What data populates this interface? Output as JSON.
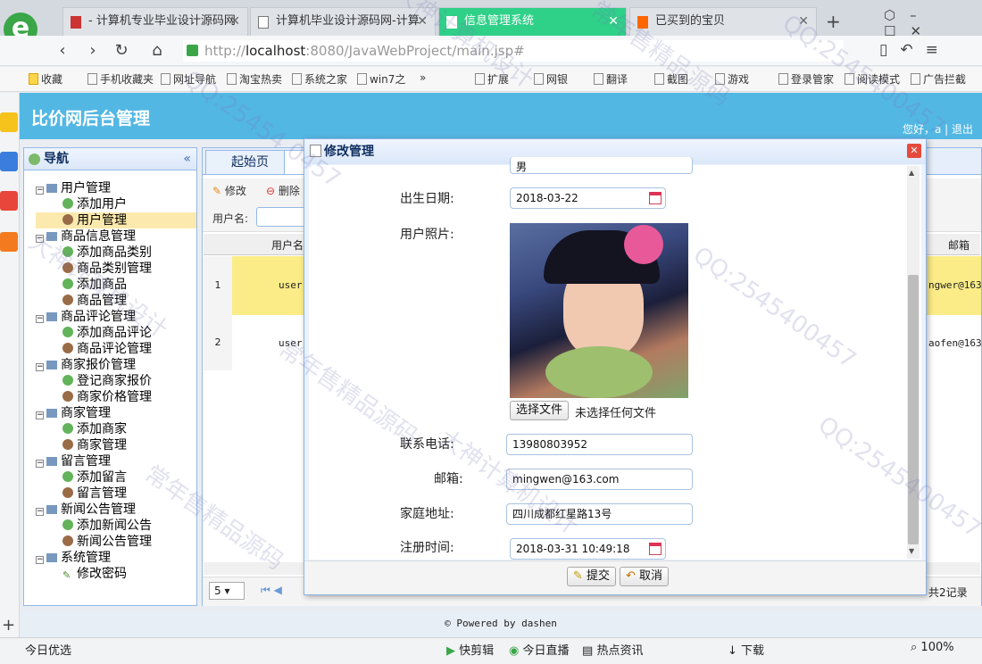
{
  "browser": {
    "tabs": [
      {
        "label": "- 计算机专业毕业设计源码网"
      },
      {
        "label": "计算机毕业设计源码网-计算"
      },
      {
        "label": "信息管理系统"
      },
      {
        "label": "已买到的宝贝"
      }
    ],
    "url_host": "localhost",
    "url_rest": ":8080/JavaWebProject/main.jsp#",
    "url_prefix": "http://",
    "bookmarks": [
      "收藏",
      "手机收藏夹",
      "网址导航",
      "淘宝热卖",
      "系统之家",
      "win7之",
      "»",
      "扩展",
      "网银",
      "翻译",
      "截图",
      "游戏",
      "登录管家",
      "阅读模式",
      "广告拦截"
    ]
  },
  "app": {
    "title": "比价网后台管理",
    "welcome": "您好，a",
    "logout": "退出",
    "nav_title": "导航",
    "footer": "© Powered by dashen"
  },
  "tree": [
    {
      "label": "用户管理",
      "level": 0
    },
    {
      "label": "添加用户",
      "level": 1
    },
    {
      "label": "用户管理",
      "level": 1,
      "selected": true
    },
    {
      "label": "商品信息管理",
      "level": 0
    },
    {
      "label": "添加商品类别",
      "level": 1
    },
    {
      "label": "商品类别管理",
      "level": 1
    },
    {
      "label": "添加商品",
      "level": 1
    },
    {
      "label": "商品管理",
      "level": 1
    },
    {
      "label": "商品评论管理",
      "level": 0
    },
    {
      "label": "添加商品评论",
      "level": 1
    },
    {
      "label": "商品评论管理",
      "level": 1
    },
    {
      "label": "商家报价管理",
      "level": 0
    },
    {
      "label": "登记商家报价",
      "level": 1
    },
    {
      "label": "商家价格管理",
      "level": 1
    },
    {
      "label": "商家管理",
      "level": 0
    },
    {
      "label": "添加商家",
      "level": 1
    },
    {
      "label": "商家管理",
      "level": 1
    },
    {
      "label": "留言管理",
      "level": 0
    },
    {
      "label": "添加留言",
      "level": 1
    },
    {
      "label": "留言管理",
      "level": 1
    },
    {
      "label": "新闻公告管理",
      "level": 0
    },
    {
      "label": "添加新闻公告",
      "level": 1
    },
    {
      "label": "新闻公告管理",
      "level": 1
    },
    {
      "label": "系统管理",
      "level": 0
    },
    {
      "label": "修改密码",
      "level": 1
    }
  ],
  "main": {
    "tab_start": "起始页",
    "toolbar": {
      "edit": "修改",
      "delete": "删除",
      "username_label": "用户名:"
    },
    "grid": {
      "col_user": "用户名",
      "col_email": "邮箱",
      "rows": [
        {
          "num": "1",
          "user": "user",
          "email": "ngwer@163"
        },
        {
          "num": "2",
          "user": "user",
          "email": "aofen@163"
        }
      ]
    },
    "pager": {
      "size": "5",
      "total": "共2记录"
    }
  },
  "modal": {
    "title": "修改管理",
    "fields": {
      "gender_value": "男",
      "birth_label": "出生日期:",
      "birth_value": "2018-03-22",
      "photo_label": "用户照片:",
      "file_button": "选择文件",
      "file_status": "未选择任何文件",
      "phone_label": "联系电话:",
      "phone_value": "13980803952",
      "email_label": "邮箱:",
      "email_value": "mingwen@163.com",
      "address_label": "家庭地址:",
      "address_value": "四川成都红星路13号",
      "regtime_label": "注册时间:",
      "regtime_value": "2018-03-31 10:49:18"
    },
    "submit": "提交",
    "cancel": "取消"
  },
  "status": {
    "left": "今日优选",
    "items": [
      "快剪辑",
      "今日直播",
      "热点资讯",
      "下载"
    ],
    "zoom": "100%"
  },
  "watermarks": [
    "QQ:25454 0457",
    "大神计算机设计",
    "常年售精品源码",
    "QQ:2545400457",
    "大神计算机设计",
    "常年售精品源码",
    "QQ:2545400457",
    "大神计算机设计",
    "常年售精品源码",
    "QQ:2545400457"
  ]
}
